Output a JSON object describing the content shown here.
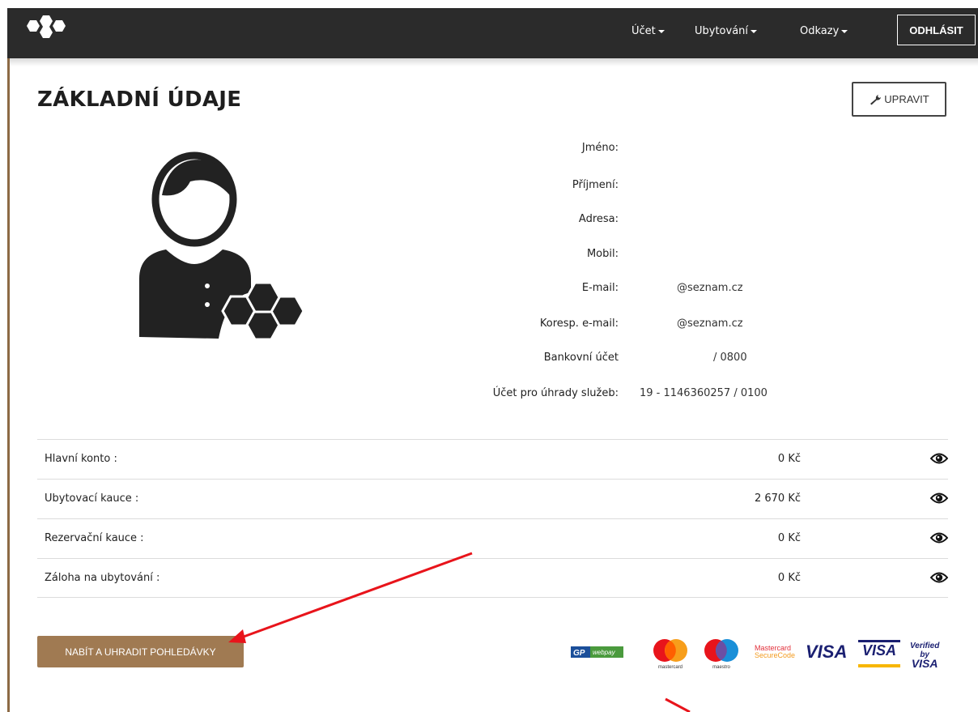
{
  "nav": {
    "items": [
      {
        "label": "Účet"
      },
      {
        "label": "Ubytování"
      },
      {
        "label": "Odkazy"
      }
    ],
    "logout_label": "ODHLÁSIT"
  },
  "page": {
    "title": "ZÁKLADNÍ ÚDAJE",
    "edit_label": "UPRAVIT"
  },
  "profile": [
    {
      "label": "Jméno:",
      "value": ""
    },
    {
      "label": "Příjmení:",
      "value": ""
    },
    {
      "label": "Adresa:",
      "value": ""
    },
    {
      "label": "Mobil:",
      "value": ""
    },
    {
      "label": "E-mail:",
      "value": "@seznam.cz"
    },
    {
      "label": "Koresp. e-mail:",
      "value": "@seznam.cz"
    },
    {
      "label": "Bankovní účet",
      "value": "/ 0800"
    },
    {
      "label": "Účet pro úhrady služeb:",
      "value": "19 - 1146360257 / 0100"
    }
  ],
  "accounts": [
    {
      "label": "Hlavní konto :",
      "value": "0 Kč"
    },
    {
      "label": "Ubytovací kauce :",
      "value": "2 670 Kč"
    },
    {
      "label": "Rezervační kauce :",
      "value": "0 Kč"
    },
    {
      "label": "Záloha na ubytování :",
      "value": "0 Kč"
    }
  ],
  "pay_button_label": "NABÍT A UHRADIT POHLEDÁVKY",
  "payment_logos": {
    "gp": "GP webpay",
    "mastercard": "mastercard",
    "maestro": "maestro",
    "securecode_line1": "Mastercard",
    "securecode_line2": "SecureCode",
    "visa": "VISA",
    "visa_electron": "VISA",
    "verified_line1": "Verified by",
    "verified_line2": "VISA"
  },
  "colors": {
    "nav_bg": "#2b2b2b",
    "accent": "#a07a52",
    "arrow": "#e8141b"
  }
}
